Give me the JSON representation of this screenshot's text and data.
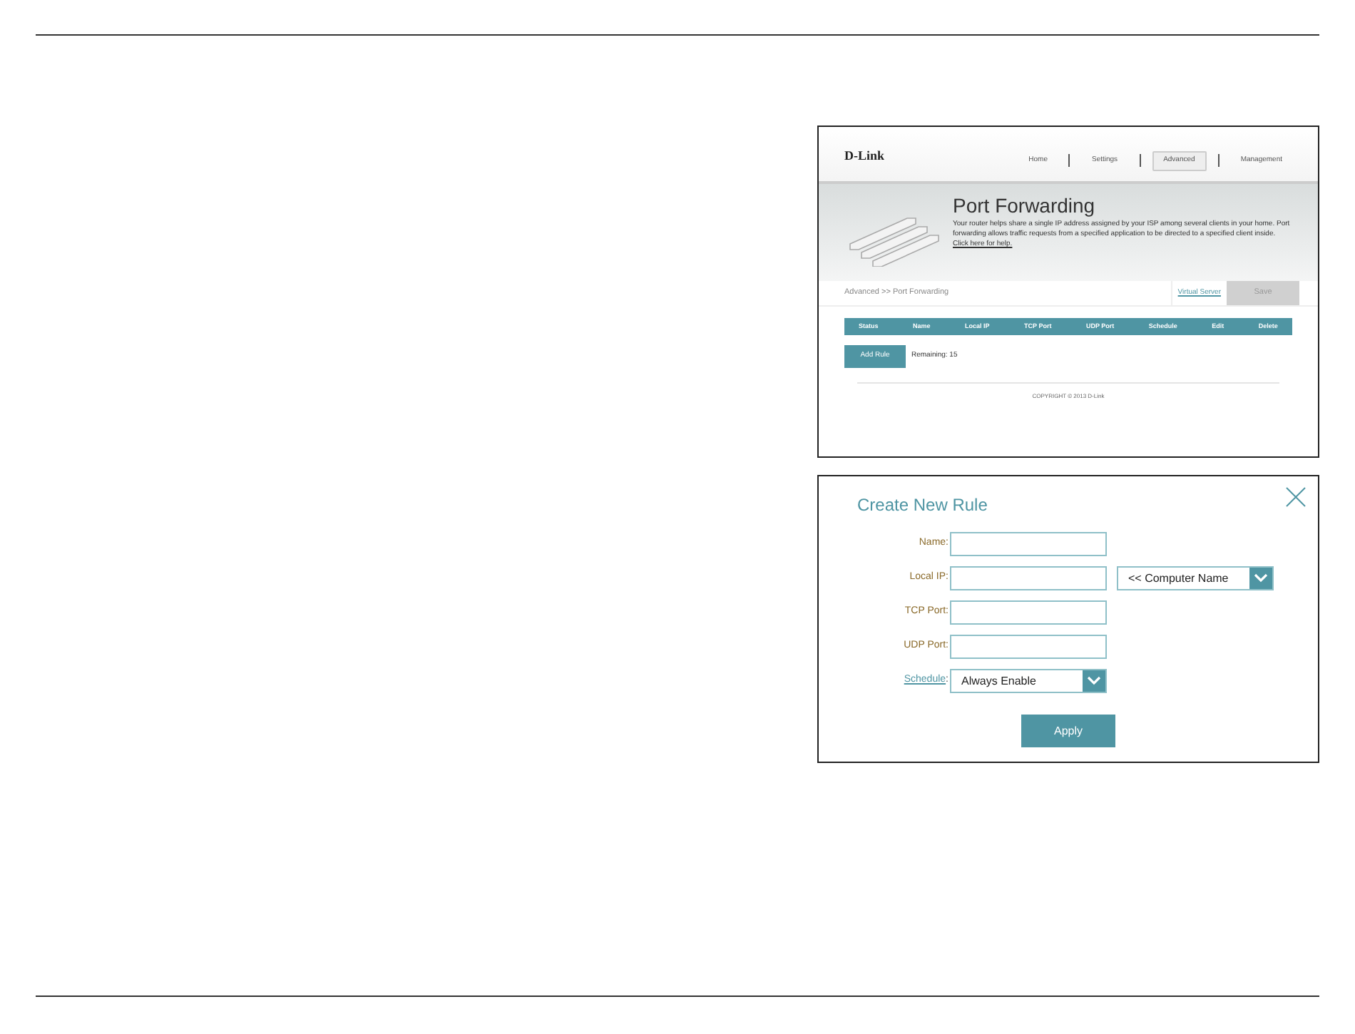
{
  "router_page": {
    "logo": "D-Link",
    "nav": [
      {
        "label": "Home",
        "selected": false
      },
      {
        "label": "Settings",
        "selected": false
      },
      {
        "label": "Advanced",
        "selected": true
      },
      {
        "label": "Management",
        "selected": false
      }
    ],
    "title": "Port Forwarding",
    "description": "Your router helps share a single IP address assigned by your ISP among several clients in your home. Port forwarding allows traffic requests from a specified application to be directed to a specified client inside.",
    "help_link": "Click here for help.",
    "breadcrumb": "Advanced >> Port Forwarding",
    "virtual_server_link": "Virtual Server",
    "save_button": {
      "label": "Save",
      "disabled": true
    },
    "table": {
      "columns": [
        "Status",
        "Name",
        "Local IP",
        "TCP Port",
        "UDP Port",
        "Schedule",
        "Edit",
        "Delete"
      ]
    },
    "add_rule_button": "Add Rule",
    "remaining": "Remaining: 15",
    "copyright": "COPYRIGHT © 2013 D-Link"
  },
  "dialog": {
    "title": "Create New Rule",
    "fields": [
      {
        "kind": "text",
        "label": "Name:"
      },
      {
        "kind": "text_select",
        "label": "Local IP:",
        "select_value": "<< Computer Name"
      },
      {
        "kind": "text",
        "label": "TCP Port:"
      },
      {
        "kind": "text",
        "label": "UDP Port:"
      },
      {
        "kind": "select",
        "label": "Schedule",
        "label_link": true,
        "label_suffix": ":",
        "value": "Always Enable"
      }
    ],
    "apply_button": "Apply"
  }
}
